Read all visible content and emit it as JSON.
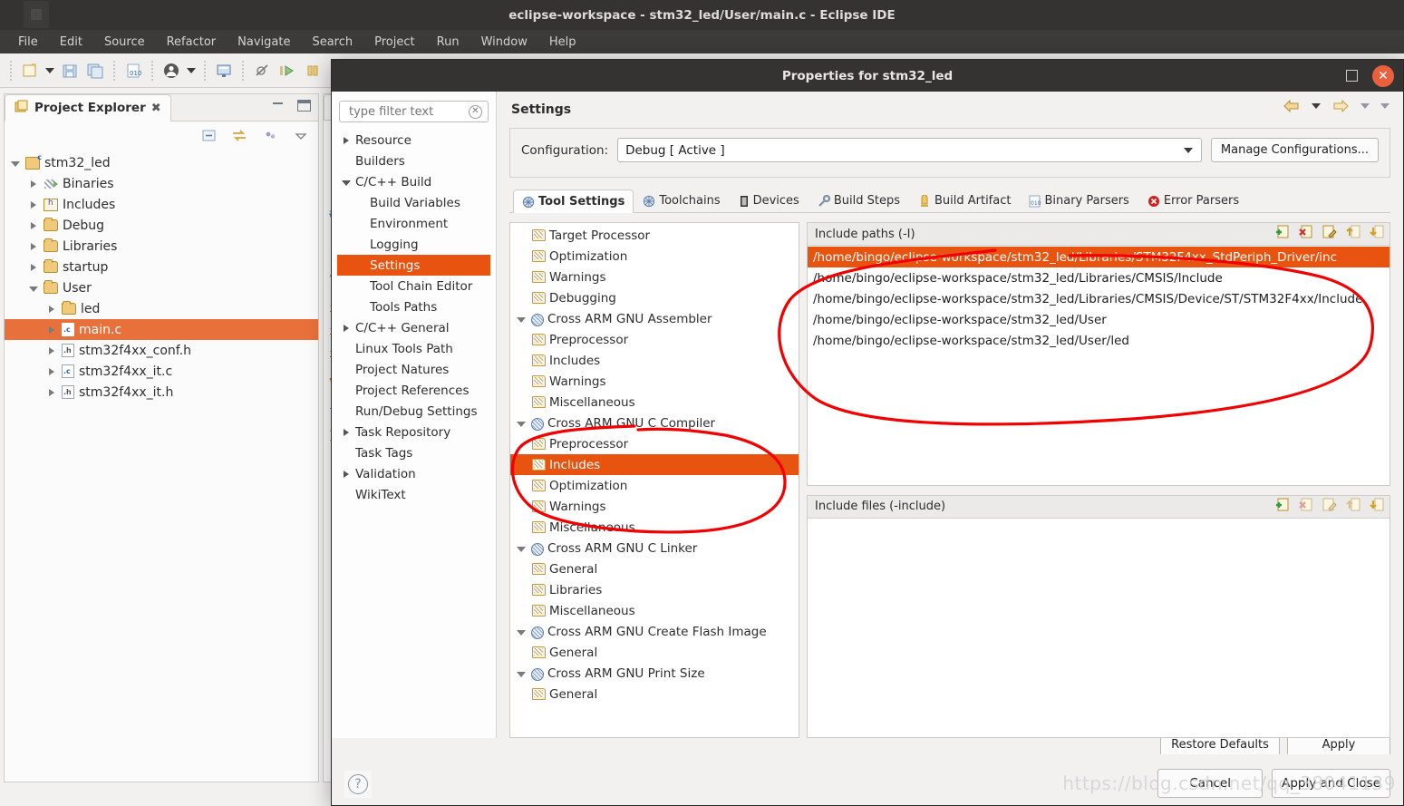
{
  "window": {
    "title": "eclipse-workspace - stm32_led/User/main.c - Eclipse IDE",
    "menus": [
      "File",
      "Edit",
      "Source",
      "Refactor",
      "Navigate",
      "Search",
      "Project",
      "Run",
      "Window",
      "Help"
    ]
  },
  "project_explorer": {
    "tab_label": "Project Explorer",
    "close_glyph": "✖",
    "tree": [
      {
        "label": "stm32_led",
        "indent": 0,
        "arrow": "down",
        "icon": "project-icon"
      },
      {
        "label": "Binaries",
        "indent": 1,
        "arrow": "right",
        "icon": "binaries-icon"
      },
      {
        "label": "Includes",
        "indent": 1,
        "arrow": "right",
        "icon": "includes-icon"
      },
      {
        "label": "Debug",
        "indent": 1,
        "arrow": "right",
        "icon": "folder-icon"
      },
      {
        "label": "Libraries",
        "indent": 1,
        "arrow": "right",
        "icon": "folder-icon"
      },
      {
        "label": "startup",
        "indent": 1,
        "arrow": "right",
        "icon": "folder-icon"
      },
      {
        "label": "User",
        "indent": 1,
        "arrow": "down",
        "icon": "folder-icon"
      },
      {
        "label": "led",
        "indent": 2,
        "arrow": "right",
        "icon": "folder-icon"
      },
      {
        "label": "main.c",
        "indent": 2,
        "arrow": "right",
        "icon": "c-file-icon",
        "selected": true
      },
      {
        "label": "stm32f4xx_conf.h",
        "indent": 2,
        "arrow": "right",
        "icon": "h-file-icon"
      },
      {
        "label": "stm32f4xx_it.c",
        "indent": 2,
        "arrow": "right",
        "icon": "c-file-icon"
      },
      {
        "label": "stm32f4xx_it.h",
        "indent": 2,
        "arrow": "right",
        "icon": "h-file-icon"
      }
    ]
  },
  "dialog": {
    "title": "Properties for stm32_led",
    "filter_placeholder": "type filter text",
    "filter_value": "",
    "page_title": "Settings",
    "left_tree": [
      {
        "label": "Resource",
        "indent": 0,
        "arrow": "right"
      },
      {
        "label": "Builders",
        "indent": 0,
        "arrow": "none"
      },
      {
        "label": "C/C++ Build",
        "indent": 0,
        "arrow": "down"
      },
      {
        "label": "Build Variables",
        "indent": 1,
        "arrow": "none"
      },
      {
        "label": "Environment",
        "indent": 1,
        "arrow": "none"
      },
      {
        "label": "Logging",
        "indent": 1,
        "arrow": "none"
      },
      {
        "label": "Settings",
        "indent": 1,
        "arrow": "none",
        "selected": true
      },
      {
        "label": "Tool Chain Editor",
        "indent": 1,
        "arrow": "none"
      },
      {
        "label": "Tools Paths",
        "indent": 1,
        "arrow": "none"
      },
      {
        "label": "C/C++ General",
        "indent": 0,
        "arrow": "right"
      },
      {
        "label": "Linux Tools Path",
        "indent": 0,
        "arrow": "none"
      },
      {
        "label": "Project Natures",
        "indent": 0,
        "arrow": "none"
      },
      {
        "label": "Project References",
        "indent": 0,
        "arrow": "none"
      },
      {
        "label": "Run/Debug Settings",
        "indent": 0,
        "arrow": "none"
      },
      {
        "label": "Task Repository",
        "indent": 0,
        "arrow": "right"
      },
      {
        "label": "Task Tags",
        "indent": 0,
        "arrow": "none"
      },
      {
        "label": "Validation",
        "indent": 0,
        "arrow": "right"
      },
      {
        "label": "WikiText",
        "indent": 0,
        "arrow": "none"
      }
    ],
    "configuration": {
      "label": "Configuration:",
      "value": "Debug [ Active ]",
      "manage_button": "Manage Configurations..."
    },
    "tabs": [
      {
        "label": "Tool Settings",
        "icon": "gear-icon",
        "active": true
      },
      {
        "label": "Toolchains",
        "icon": "gear-icon",
        "active": false
      },
      {
        "label": "Devices",
        "icon": "chip-icon",
        "active": false
      },
      {
        "label": "Build Steps",
        "icon": "wrench-icon",
        "active": false
      },
      {
        "label": "Build Artifact",
        "icon": "artifact-icon",
        "active": false
      },
      {
        "label": "Binary Parsers",
        "icon": "binary-file-icon",
        "active": false
      },
      {
        "label": "Error Parsers",
        "icon": "error-icon",
        "active": false
      }
    ],
    "tool_tree": [
      {
        "label": "Target Processor",
        "indent": 1,
        "arrow": "none",
        "icon": "doc-icon"
      },
      {
        "label": "Optimization",
        "indent": 1,
        "arrow": "none",
        "icon": "doc-icon"
      },
      {
        "label": "Warnings",
        "indent": 1,
        "arrow": "none",
        "icon": "doc-icon"
      },
      {
        "label": "Debugging",
        "indent": 1,
        "arrow": "none",
        "icon": "doc-icon"
      },
      {
        "label": "Cross ARM GNU Assembler",
        "indent": 0,
        "arrow": "down",
        "icon": "gear-icon"
      },
      {
        "label": "Preprocessor",
        "indent": 1,
        "arrow": "none",
        "icon": "doc-icon"
      },
      {
        "label": "Includes",
        "indent": 1,
        "arrow": "none",
        "icon": "doc-icon"
      },
      {
        "label": "Warnings",
        "indent": 1,
        "arrow": "none",
        "icon": "doc-icon"
      },
      {
        "label": "Miscellaneous",
        "indent": 1,
        "arrow": "none",
        "icon": "doc-icon"
      },
      {
        "label": "Cross ARM GNU C Compiler",
        "indent": 0,
        "arrow": "down",
        "icon": "gear-icon"
      },
      {
        "label": "Preprocessor",
        "indent": 1,
        "arrow": "none",
        "icon": "doc-icon"
      },
      {
        "label": "Includes",
        "indent": 1,
        "arrow": "none",
        "icon": "doc-icon",
        "selected": true
      },
      {
        "label": "Optimization",
        "indent": 1,
        "arrow": "none",
        "icon": "doc-icon"
      },
      {
        "label": "Warnings",
        "indent": 1,
        "arrow": "none",
        "icon": "doc-icon"
      },
      {
        "label": "Miscellaneous",
        "indent": 1,
        "arrow": "none",
        "icon": "doc-icon"
      },
      {
        "label": "Cross ARM GNU C Linker",
        "indent": 0,
        "arrow": "down",
        "icon": "gear-icon"
      },
      {
        "label": "General",
        "indent": 1,
        "arrow": "none",
        "icon": "doc-icon"
      },
      {
        "label": "Libraries",
        "indent": 1,
        "arrow": "none",
        "icon": "doc-icon"
      },
      {
        "label": "Miscellaneous",
        "indent": 1,
        "arrow": "none",
        "icon": "doc-icon"
      },
      {
        "label": "Cross ARM GNU Create Flash Image",
        "indent": 0,
        "arrow": "down",
        "icon": "gear-icon"
      },
      {
        "label": "General",
        "indent": 1,
        "arrow": "none",
        "icon": "doc-icon"
      },
      {
        "label": "Cross ARM GNU Print Size",
        "indent": 0,
        "arrow": "down",
        "icon": "gear-icon"
      },
      {
        "label": "General",
        "indent": 1,
        "arrow": "none",
        "icon": "doc-icon"
      }
    ],
    "include_paths": {
      "title": "Include paths (-I)",
      "actions": [
        "add-icon",
        "delete-icon",
        "edit-icon",
        "move-up-icon",
        "move-down-icon"
      ],
      "items": [
        {
          "path": "/home/bingo/eclipse-workspace/stm32_led/Libraries/STM32F4xx_StdPeriph_Driver/inc",
          "selected": true
        },
        {
          "path": "/home/bingo/eclipse-workspace/stm32_led/Libraries/CMSIS/Include"
        },
        {
          "path": "/home/bingo/eclipse-workspace/stm32_led/Libraries/CMSIS/Device/ST/STM32F4xx/Include"
        },
        {
          "path": "/home/bingo/eclipse-workspace/stm32_led/User"
        },
        {
          "path": "/home/bingo/eclipse-workspace/stm32_led/User/led"
        }
      ]
    },
    "include_files": {
      "title": "Include files (-include)",
      "actions": [
        "add-icon",
        "delete-icon",
        "edit-icon",
        "move-up-icon",
        "move-down-icon"
      ],
      "items": []
    },
    "footer": {
      "restore_defaults": "Restore Defaults",
      "apply": "Apply",
      "cancel": "Cancel",
      "apply_and_close": "Apply and Close",
      "help": "?"
    },
    "watermark": "https://blog.csdn.net/qq_38041139"
  },
  "colors": {
    "accent_orange": "#e8530f",
    "selection_orange": "#e8703a",
    "annotation_red": "#f00000",
    "titlebar_dark": "#353331",
    "close_button": "#e8603c"
  }
}
